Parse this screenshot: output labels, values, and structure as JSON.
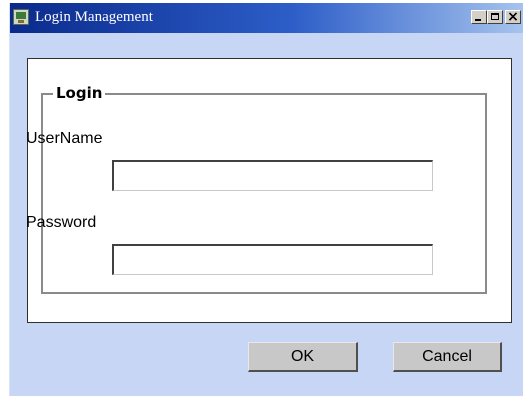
{
  "window": {
    "title": "Login Management"
  },
  "login": {
    "legend": "Login",
    "username_label": "UserName",
    "username_value": "",
    "password_label": "Password",
    "password_value": ""
  },
  "buttons": {
    "ok_label": "OK",
    "cancel_label": "Cancel"
  },
  "icons": {
    "app": "computer-icon",
    "minimize": "minimize-icon",
    "maximize": "maximize-icon",
    "close": "close-icon"
  },
  "colors": {
    "titlebar_start": "#0a2a8c",
    "titlebar_end": "#a6c4ee",
    "window_background": "#c6d6f4"
  }
}
